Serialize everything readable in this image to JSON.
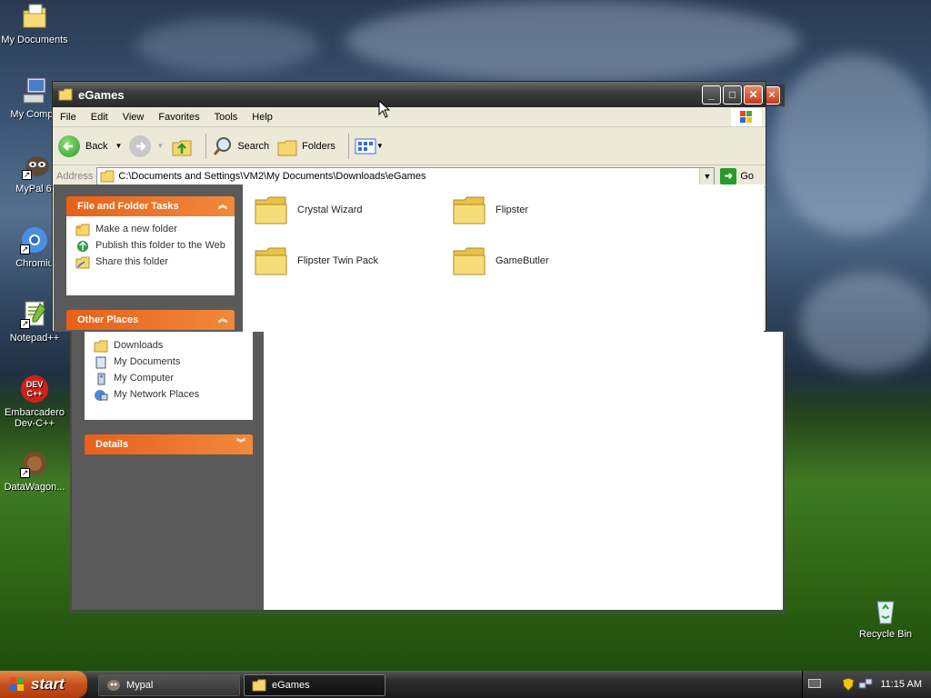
{
  "desktop": {
    "icons": [
      {
        "label": "My Documents",
        "icon": "my-documents-icon"
      },
      {
        "label": "My Compu",
        "icon": "my-computer-icon"
      },
      {
        "label": "MyPal 68",
        "icon": "mypal-icon"
      },
      {
        "label": "Chromiu",
        "icon": "chromium-icon"
      },
      {
        "label": "Notepad++",
        "icon": "notepadpp-icon"
      },
      {
        "label": "Embarcadero",
        "label2": "Dev-C++",
        "icon": "devcpp-icon"
      },
      {
        "label": "DataWagon...",
        "icon": "datawagon-icon"
      },
      {
        "label": "Recycle Bin",
        "icon": "recycle-bin-icon"
      }
    ]
  },
  "window": {
    "title": "eGames",
    "menu": [
      "File",
      "Edit",
      "View",
      "Favorites",
      "Tools",
      "Help"
    ],
    "toolbar": {
      "back": "Back",
      "search": "Search",
      "folders": "Folders"
    },
    "address": {
      "label": "Address",
      "value": "C:\\Documents and Settings\\VM2\\My Documents\\Downloads\\eGames",
      "go": "Go"
    },
    "tasks_panel": {
      "title": "File and Folder Tasks",
      "items": [
        "Make a new folder",
        "Publish this folder to the Web",
        "Share this folder"
      ]
    },
    "places_panel": {
      "title": "Other Places",
      "items": [
        "Downloads",
        "My Documents",
        "My Computer",
        "My Network Places"
      ]
    },
    "details_panel": {
      "title": "Details"
    },
    "folders": [
      "Crystal Wizard",
      "Flipster",
      "Flipster Twin Pack",
      "GameButler"
    ]
  },
  "taskbar": {
    "start": "start",
    "tasks": [
      "Mypal",
      "eGames"
    ],
    "clock": "11:15 AM"
  },
  "colors": {
    "panel_header": "#e8601a",
    "titlebar": "#3c3c3c",
    "folder": "#f5d76e"
  }
}
